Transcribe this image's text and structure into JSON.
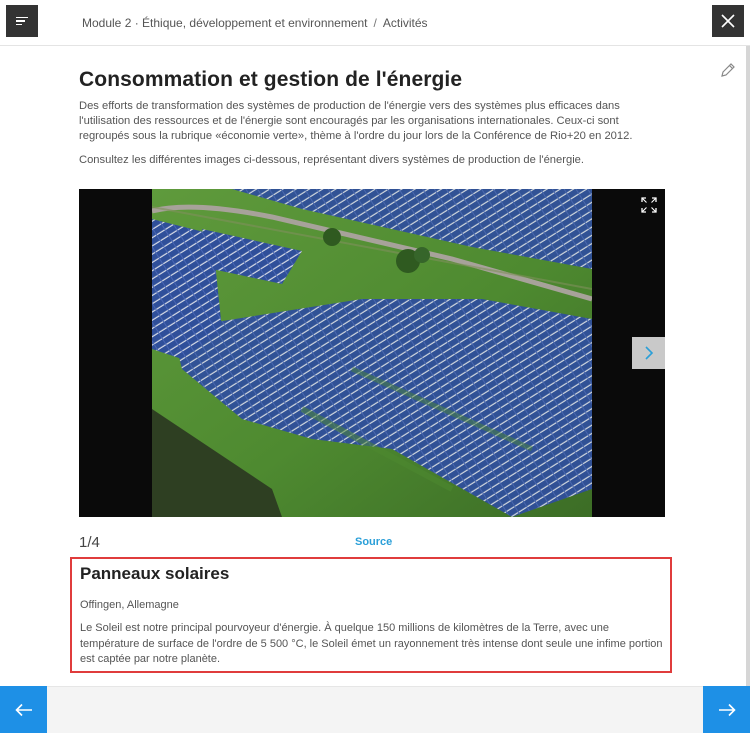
{
  "header": {
    "menu_icon": "menu-lines-icon",
    "breadcrumb_module": "Module 2 · Éthique, développement et environnement",
    "breadcrumb_separator": "/",
    "breadcrumb_section": "Activités",
    "close_icon": "close-icon"
  },
  "main": {
    "title": "Consommation et gestion de l'énergie",
    "paragraph1": "Des efforts de transformation des systèmes de production de l'énergie vers des systèmes plus efficaces dans l'utilisation des ressources et de l'énergie sont encouragés par les organisations internationales. Ceux-ci sont regroupés sous la rubrique «économie verte», thème à l'ordre du jour lors de la Conférence de Rio+20 en 2012.",
    "paragraph2": "Consultez les différentes images ci-dessous, représentant divers systèmes de production de l'énergie.",
    "edit_icon": "pencil-icon"
  },
  "carousel": {
    "counter": "1/4",
    "source_label": "Source",
    "expand_icon": "expand-icon",
    "next_icon": "chevron-right-icon"
  },
  "caption": {
    "title": "Panneaux solaires",
    "location": "Offingen, Allemagne",
    "description": "Le Soleil est notre principal pourvoyeur d'énergie. À quelque 150 millions de kilomètres de la Terre, avec une température de surface de l'ordre de 5 500 °C, le Soleil émet un rayonnement très intense dont seule une infime portion est captée par notre planète."
  },
  "footer": {
    "prev_icon": "arrow-left-icon",
    "next_icon": "arrow-right-icon"
  },
  "colors": {
    "accent": "#1e90e6",
    "highlight_border": "#e03c3c",
    "link": "#2a9fd8",
    "dark_button": "#333333"
  }
}
